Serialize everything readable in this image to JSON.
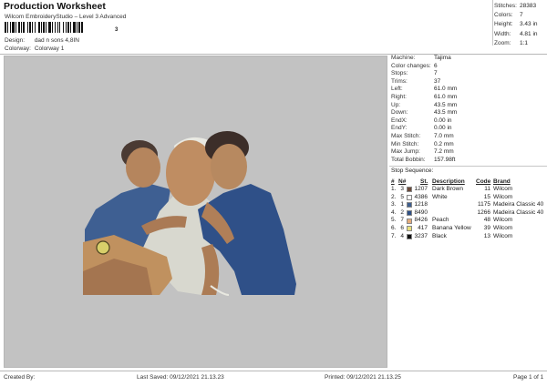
{
  "header": {
    "title": "Production Worksheet",
    "subtitle": "Wilcom EmbroideryStudio – Level 3 Advanced",
    "barcode_number": "3",
    "design_label": "Design:",
    "design_value": "dad n sons 4,8IN",
    "colorway_label": "Colorway:",
    "colorway_value": "Colorway 1"
  },
  "stats": [
    {
      "label": "Stitches:",
      "value": "28383"
    },
    {
      "label": "Colors:",
      "value": "7"
    },
    {
      "label": "Height:",
      "value": "3.43 in"
    },
    {
      "label": "Width:",
      "value": "4.81 in"
    },
    {
      "label": "Zoom:",
      "value": "1:1"
    }
  ],
  "machine_info": [
    {
      "label": "Machine:",
      "value": "Tajima"
    },
    {
      "label": "Color changes:",
      "value": "6"
    },
    {
      "label": "Stops:",
      "value": "7"
    },
    {
      "label": "Trims:",
      "value": "37"
    },
    {
      "label": "Left:",
      "value": "61.0 mm"
    },
    {
      "label": "Right:",
      "value": "61.0 mm"
    },
    {
      "label": "Up:",
      "value": "43.5 mm"
    },
    {
      "label": "Down:",
      "value": "43.5 mm"
    },
    {
      "label": "EndX:",
      "value": "0.00 in"
    },
    {
      "label": "EndY:",
      "value": "0.00 in"
    },
    {
      "label": "Max Stitch:",
      "value": "7.0 mm"
    },
    {
      "label": "Min Stitch:",
      "value": "0.2 mm"
    },
    {
      "label": "Max Jump:",
      "value": "7.2 mm"
    },
    {
      "label": "Total Bobbin:",
      "value": "157.98ft"
    }
  ],
  "stop_sequence": {
    "title": "Stop Sequence:",
    "headers": {
      "hash": "#",
      "n": "N#",
      "st": "St.",
      "description": "Description",
      "code": "Code",
      "brand": "Brand"
    },
    "rows": [
      {
        "num": "1.",
        "n": "3",
        "st": "1207",
        "description": "Dark Brown",
        "code": "11",
        "brand": "Wilcom",
        "color": "#6b4a3a"
      },
      {
        "num": "2.",
        "n": "5",
        "st": "4386",
        "description": "White",
        "code": "15",
        "brand": "Wilcom",
        "color": "#ffffff"
      },
      {
        "num": "3.",
        "n": "1",
        "st": "1218",
        "description": "",
        "code": "1175",
        "brand": "Madeira Classic 40",
        "color": "#3f5f8f"
      },
      {
        "num": "4.",
        "n": "2",
        "st": "8490",
        "description": "",
        "code": "1266",
        "brand": "Madeira Classic 40",
        "color": "#2d4f86"
      },
      {
        "num": "5.",
        "n": "7",
        "st": "8426",
        "description": "Peach",
        "code": "48",
        "brand": "Wilcom",
        "color": "#e3ab7c"
      },
      {
        "num": "6.",
        "n": "6",
        "st": "417",
        "description": "Banana Yellow",
        "code": "39",
        "brand": "Wilcom",
        "color": "#e8e07c"
      },
      {
        "num": "7.",
        "n": "4",
        "st": "3237",
        "description": "Black",
        "code": "13",
        "brand": "Wilcom",
        "color": "#111111"
      }
    ]
  },
  "footer": {
    "created_by": "Created By:",
    "last_saved": "Last Saved: 09/12/2021 21.13.23",
    "printed": "Printed: 09/12/2021 21.13.25",
    "page": "Page 1 of 1"
  }
}
